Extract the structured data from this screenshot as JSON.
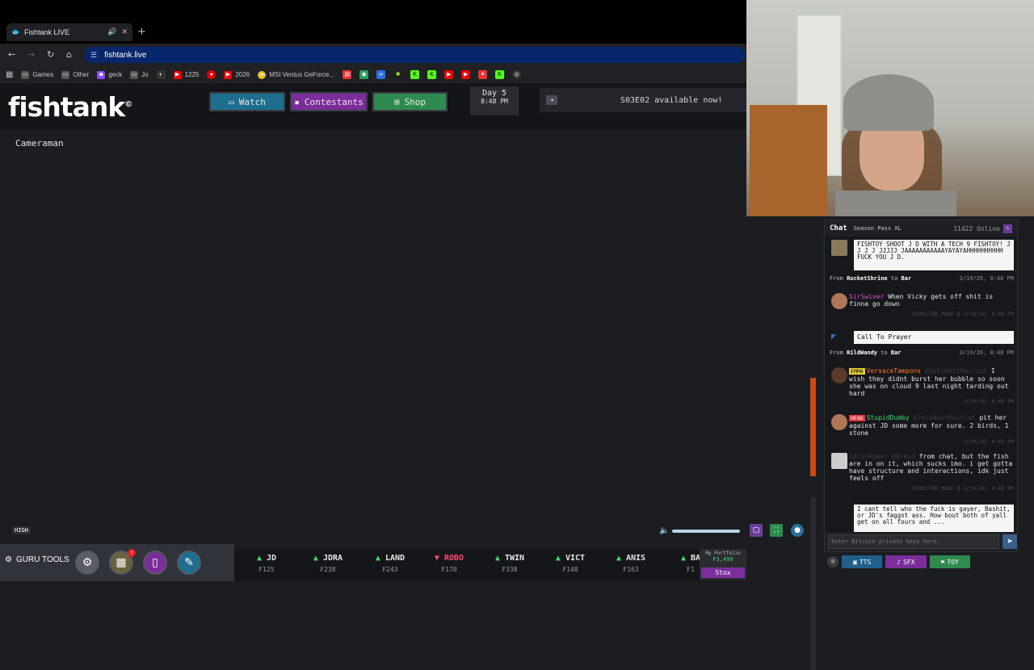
{
  "browser": {
    "tab_title": "Fishtank LIVE",
    "new_tab": "+",
    "url": "fishtank.live",
    "bookmarks": [
      {
        "label": "Games",
        "icon": "folder-icon",
        "color": "#8a8a8a"
      },
      {
        "label": "Other",
        "icon": "folder-icon",
        "color": "#8a8a8a"
      },
      {
        "label": "geck",
        "icon": "twitch-icon",
        "color": "#9146ff"
      },
      {
        "label": "Jo",
        "icon": "folder-icon",
        "color": "#8a8a8a"
      },
      {
        "label": "1225",
        "icon": "youtube-icon",
        "color": "#ff0000"
      },
      {
        "label": "2026",
        "icon": "youtube-icon",
        "color": "#ff0000"
      },
      {
        "label": "MSI Ventus GeForce...",
        "icon": "lemon-icon",
        "color": "#e8c22a"
      }
    ]
  },
  "site": {
    "logo": "fishtank",
    "logo_mark": "©",
    "nav": {
      "watch": "Watch",
      "contestants": "Contestants",
      "shop": "Shop"
    },
    "day": "Day 5",
    "time": "8:48 PM",
    "announcement": "S03E02 available now!"
  },
  "player": {
    "camera_name": "Cameraman",
    "quality": "HIGH"
  },
  "chat": {
    "title": "Chat",
    "season_pass": "Season Pass XL",
    "online": "11422 Online",
    "input_placeholder": "Enter Bitcoin private keys here.",
    "tts_1": "FISHTOY  SHOOT J D WITH A TECH 9 FISHTOY! J J J J JJJJJ JAAAAAAAAAAAYAYAYAHHHHHHHHHH FUCK YOU J D.",
    "from_1_user": "RocketShrine",
    "from_1_loc": "Bar",
    "from_1_time": "3/19/26, 8:48 PM",
    "msg_1_user": "SirSwiver",
    "msg_1_text": "When Vicky gets off shit is finna go down",
    "msg_1_meta": "DIRECTOR MODE @ 3/19/26, 8:48 PM",
    "tts_2": "Call To Prayer",
    "from_2_user": "RildWandy",
    "from_2_loc": "Bar",
    "from_2_time": "3/19/26, 8:48 PM",
    "msg_2_badge": "EMMA",
    "msg_2_user": "VersaceTampons",
    "msg_2_mention": "@JetsNextHaircut",
    "msg_2_text": "I wish they didnt burst her bubble so soon she was on cloud 9 last night tarding out hard",
    "msg_2_meta": "3/19/26, 8:48 PM",
    "msg_3_badge": "HEAD",
    "msg_3_user": "StupidDumby",
    "msg_3_mention": "@JetsNextHaircut",
    "msg_3_text": "pit her against JD some more for sure. 2 birds, 1 stone",
    "msg_3_meta": "3/19/26, 8:48 PM",
    "msg_4_user": "idrinkbeer",
    "msg_4_mention": "@Bread",
    "msg_4_text": "from chat, but the fish are in on it, which sucks imo. i get gotta have structure and interactions, idk just feels off",
    "msg_4_meta": "DIRECTOR MODE @ 3/19/26, 8:48 PM",
    "tts_3": "I cant tell who the fuck is gayer, Bashit, or JD's faggot ass. How bout both of yall get on all fours and ...",
    "actions": {
      "tts": "TTS",
      "sfx": "SFX",
      "toy": "TOY"
    }
  },
  "bottom": {
    "guru_tools": "GURU TOOLS",
    "alert_count": "!"
  },
  "ticker": [
    {
      "symbol": "JD",
      "price": "₣125",
      "dir": "up"
    },
    {
      "symbol": "JDRA",
      "price": "₣238",
      "dir": "up"
    },
    {
      "symbol": "LAND",
      "price": "₣243",
      "dir": "up"
    },
    {
      "symbol": "ROBO",
      "price": "₣170",
      "dir": "down"
    },
    {
      "symbol": "TWIN",
      "price": "₣338",
      "dir": "up"
    },
    {
      "symbol": "VICT",
      "price": "₣148",
      "dir": "up"
    },
    {
      "symbol": "ANIS",
      "price": "₣163",
      "dir": "up"
    },
    {
      "symbol": "BA",
      "price": "₣1",
      "dir": "up"
    }
  ],
  "portfolio": {
    "label": "My Portfolio",
    "value": "₣3,499",
    "button": "Stox"
  }
}
